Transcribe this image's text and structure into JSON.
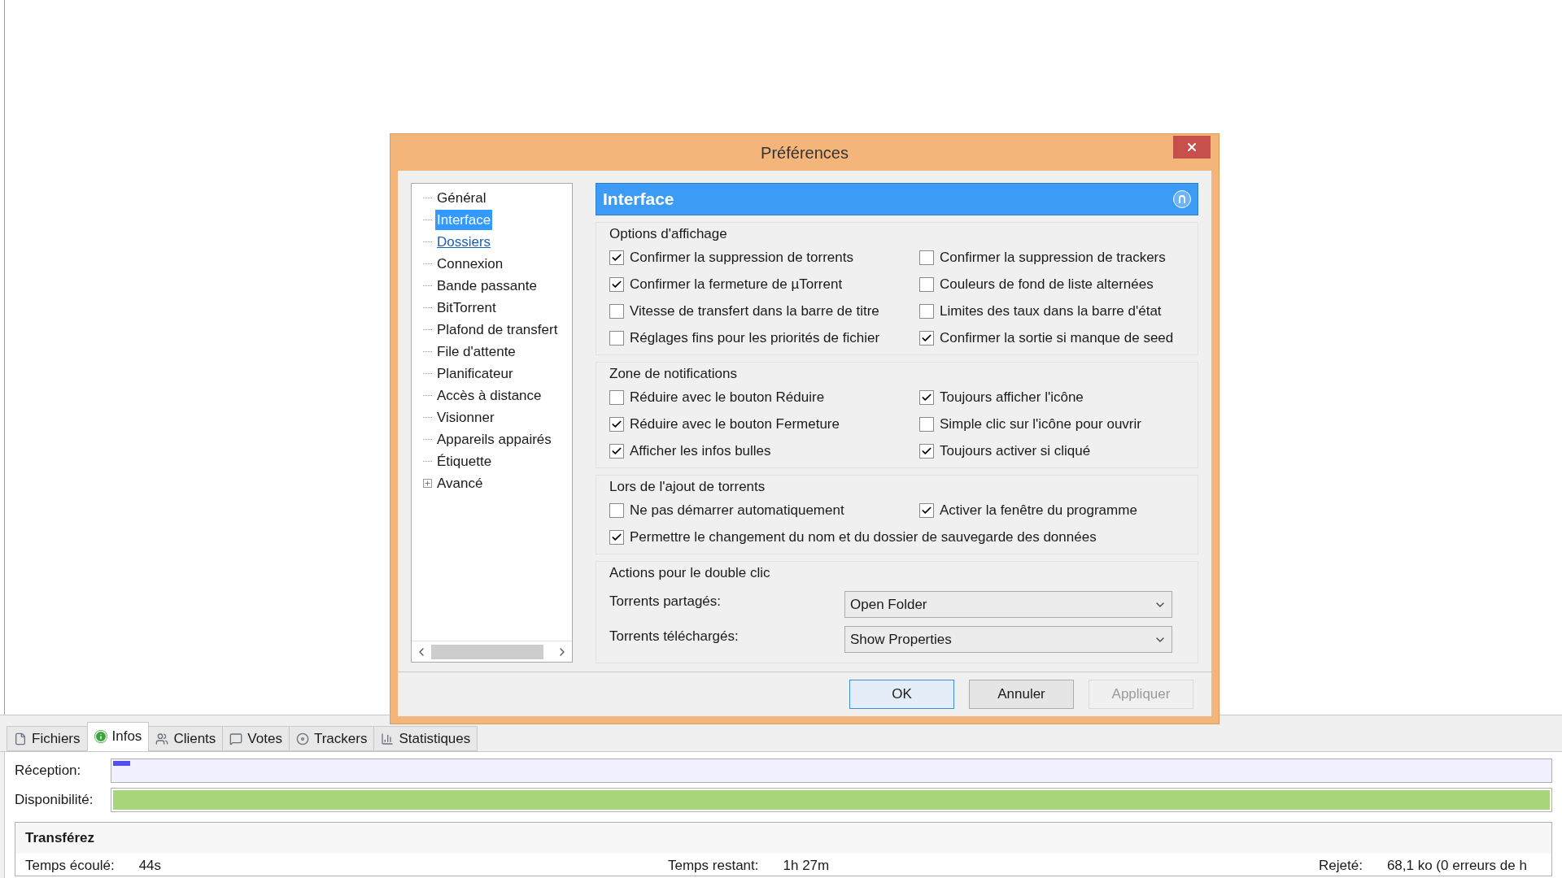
{
  "dialog": {
    "title": "Préférences",
    "tree": [
      {
        "label": "Général",
        "selected": false,
        "hovered": false,
        "kind": "leaf"
      },
      {
        "label": "Interface",
        "selected": true,
        "hovered": false,
        "kind": "leaf"
      },
      {
        "label": "Dossiers",
        "selected": false,
        "hovered": true,
        "kind": "leaf"
      },
      {
        "label": "Connexion",
        "selected": false,
        "hovered": false,
        "kind": "leaf"
      },
      {
        "label": "Bande passante",
        "selected": false,
        "hovered": false,
        "kind": "leaf"
      },
      {
        "label": "BitTorrent",
        "selected": false,
        "hovered": false,
        "kind": "leaf"
      },
      {
        "label": "Plafond de transfert",
        "selected": false,
        "hovered": false,
        "kind": "leaf"
      },
      {
        "label": "File d'attente",
        "selected": false,
        "hovered": false,
        "kind": "leaf"
      },
      {
        "label": "Planificateur",
        "selected": false,
        "hovered": false,
        "kind": "leaf"
      },
      {
        "label": "Accès à distance",
        "selected": false,
        "hovered": false,
        "kind": "leaf"
      },
      {
        "label": "Visionner",
        "selected": false,
        "hovered": false,
        "kind": "leaf"
      },
      {
        "label": "Appareils appairés",
        "selected": false,
        "hovered": false,
        "kind": "leaf"
      },
      {
        "label": "Étiquette",
        "selected": false,
        "hovered": false,
        "kind": "leaf"
      },
      {
        "label": "Avancé",
        "selected": false,
        "hovered": false,
        "kind": "group"
      }
    ],
    "panel_title": "Interface",
    "sections": [
      {
        "title": "Options d'affichage",
        "rows": [
          [
            {
              "label": "Confirmer la suppression de torrents",
              "checked": true
            },
            {
              "label": "Confirmer la suppression de trackers",
              "checked": false
            }
          ],
          [
            {
              "label": "Confirmer la fermeture de µTorrent",
              "checked": true
            },
            {
              "label": "Couleurs de fond de liste alternées",
              "checked": false
            }
          ],
          [
            {
              "label": "Vitesse de transfert dans la barre de titre",
              "checked": false
            },
            {
              "label": "Limites des taux dans la barre d'état",
              "checked": false
            }
          ],
          [
            {
              "label": "Réglages fins pour les priorités de fichier",
              "checked": false
            },
            {
              "label": "Confirmer la sortie si manque de seed",
              "checked": true
            }
          ]
        ]
      },
      {
        "title": "Zone de notifications",
        "rows": [
          [
            {
              "label": "Réduire avec le bouton Réduire",
              "checked": false
            },
            {
              "label": "Toujours afficher l'icône",
              "checked": true
            }
          ],
          [
            {
              "label": "Réduire avec le bouton Fermeture",
              "checked": true
            },
            {
              "label": "Simple clic sur l'icône pour ouvrir",
              "checked": false
            }
          ],
          [
            {
              "label": "Afficher les infos bulles",
              "checked": true
            },
            {
              "label": "Toujours activer si cliqué",
              "checked": true
            }
          ]
        ]
      },
      {
        "title": "Lors de l'ajout de torrents",
        "rows": [
          [
            {
              "label": "Ne pas démarrer automatiquement",
              "checked": false
            },
            {
              "label": "Activer la fenêtre du programme",
              "checked": true
            }
          ],
          [
            {
              "label": "Permettre le changement du nom et du dossier de sauvegarde des données",
              "checked": true
            }
          ]
        ]
      }
    ],
    "actions": {
      "title": "Actions pour le double clic",
      "fields": [
        {
          "label": "Torrents partagés:",
          "value": "Open Folder"
        },
        {
          "label": "Torrents téléchargés:",
          "value": "Show Properties"
        }
      ]
    },
    "buttons": [
      {
        "label": "OK",
        "default": true,
        "disabled": false
      },
      {
        "label": "Annuler",
        "default": false,
        "disabled": false
      },
      {
        "label": "Appliquer",
        "default": false,
        "disabled": true
      }
    ]
  },
  "tabs": [
    {
      "label": "Fichiers",
      "selected": false,
      "kind": "files"
    },
    {
      "label": "Infos",
      "selected": true,
      "kind": "info"
    },
    {
      "label": "Clients",
      "selected": false,
      "kind": "clients"
    },
    {
      "label": "Votes",
      "selected": false,
      "kind": "votes"
    },
    {
      "label": "Trackers",
      "selected": false,
      "kind": "trackers"
    },
    {
      "label": "Statistiques",
      "selected": false,
      "kind": "stats"
    }
  ],
  "bars": [
    {
      "label": "Réception:",
      "level": 0.012,
      "kind": "reception"
    },
    {
      "label": "Disponibilité:",
      "level": 1,
      "kind": "availability"
    }
  ],
  "transfer": {
    "title": "Transférez",
    "fields": [
      {
        "label": "Temps écoulé:",
        "value": "44s"
      },
      {
        "label": "Temps restant:",
        "value": "1h 27m"
      },
      {
        "label": "Rejeté:",
        "value": "68,1 ko (0 erreurs de h"
      }
    ]
  }
}
